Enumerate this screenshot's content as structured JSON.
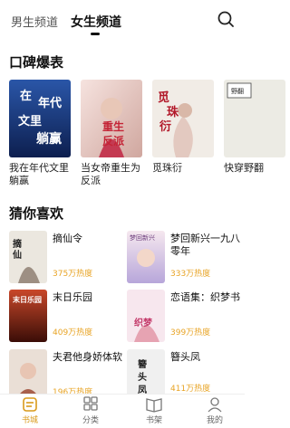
{
  "header": {
    "tabs": [
      {
        "label": "男生频道",
        "active": false
      },
      {
        "label": "女生频道",
        "active": true
      }
    ],
    "search_icon": "search-icon"
  },
  "recommend": {
    "title": "口碑爆表",
    "books": [
      {
        "title": "我在年代文里躺赢",
        "cover_text": "在年代文里躺赢",
        "colors": [
          "#1d3f8a",
          "#0f2454"
        ]
      },
      {
        "title": "当女帝重生为反派",
        "cover_text": "重生为反派",
        "colors": [
          "#f2d7d5",
          "#c9465a"
        ]
      },
      {
        "title": "觅珠衍",
        "cover_text": "觅珠衍",
        "colors": [
          "#f4f0ea",
          "#d7c8bb"
        ]
      },
      {
        "title": "快穿野翻",
        "cover_text": "",
        "colors": [
          "#ecece6",
          "#bfbfb6"
        ],
        "cover_tag": "野翻"
      }
    ]
  },
  "guess": {
    "title": "猜你喜欢",
    "books": [
      {
        "title": "摘仙令",
        "heat": "375万热度",
        "cover_text": "摘仙令",
        "colors": [
          "#e7e3dc",
          "#9b8f82"
        ]
      },
      {
        "title": "梦回新兴一九八零年",
        "heat": "333万热度",
        "cover_text": "梦回新兴",
        "colors": [
          "#f2e2ea",
          "#b3a2d6"
        ]
      },
      {
        "title": "末日乐园",
        "heat": "409万热度",
        "cover_text": "末日乐园",
        "colors": [
          "#b73a1f",
          "#3a0f08"
        ]
      },
      {
        "title": "恋语集：织梦书",
        "heat": "399万热度",
        "cover_text": "织梦书",
        "colors": [
          "#f7e7ef",
          "#e29aa9"
        ]
      },
      {
        "title": "夫君他身娇体软",
        "heat": "196万热度",
        "cover_text": "身娇体软",
        "colors": [
          "#e9ddd4",
          "#a66a56"
        ]
      },
      {
        "title": "簪头凤",
        "heat": "411万热度",
        "cover_text": "簪头凤",
        "colors": [
          "#efefef",
          "#9a9a9a"
        ]
      }
    ]
  },
  "bottom_nav": [
    {
      "label": "书城",
      "icon": "bookstore-icon",
      "active": true
    },
    {
      "label": "分类",
      "icon": "category-grid-icon",
      "active": false
    },
    {
      "label": "书架",
      "icon": "bookshelf-icon",
      "active": false
    },
    {
      "label": "我的",
      "icon": "profile-icon",
      "active": false
    }
  ],
  "colors": {
    "accent": "#d99a1a",
    "heat": "#e8a426",
    "text": "#111111"
  }
}
